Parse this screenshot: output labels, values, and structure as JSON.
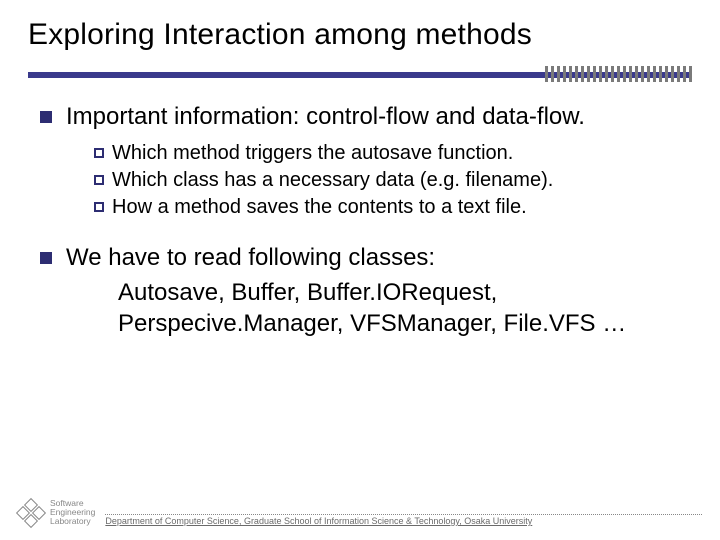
{
  "title": "Exploring Interaction among methods",
  "bullets": [
    {
      "text": "Important information: control-flow and data-flow.",
      "sub": [
        "Which method triggers the autosave function.",
        "Which class has a necessary data (e.g. filename).",
        "How a method saves the contents to a text file."
      ]
    },
    {
      "text": "We have to read following classes:",
      "classes": [
        "Autosave, Buffer, Buffer.IORequest,",
        "Perspecive.Manager, VFSManager, File.VFS …"
      ]
    }
  ],
  "logo": {
    "line1": "Software",
    "line2": "Engineering",
    "line3": "Laboratory"
  },
  "footer": "Department of Computer Science, Graduate School of Information Science & Technology, Osaka University"
}
